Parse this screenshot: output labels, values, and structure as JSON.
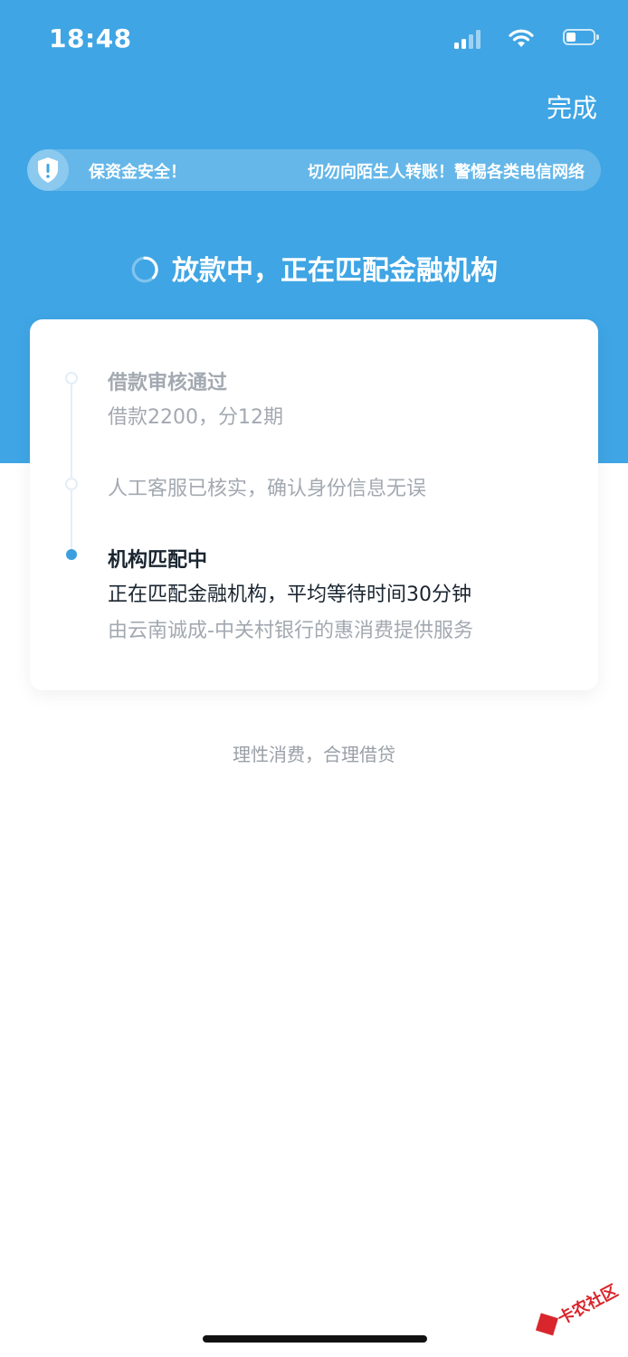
{
  "status_bar": {
    "time": "18:48"
  },
  "header": {
    "done_label": "完成"
  },
  "notice": {
    "left_text": "保资金安全！",
    "right_text": "切勿向陌生人转账！警惕各类电信网络"
  },
  "status": {
    "title": "放款中，正在匹配金融机构"
  },
  "timeline": {
    "steps": [
      {
        "title": "借款审核通过",
        "detail": "借款2200，分12期",
        "state": "done"
      },
      {
        "title": "",
        "detail": "人工客服已核实，确认身份信息无误",
        "state": "done"
      },
      {
        "title": "机构匹配中",
        "detail": "正在匹配金融机构，平均等待时间30分钟",
        "note": "由云南诚成-中关村银行的惠消费提供服务",
        "state": "active"
      }
    ]
  },
  "footer": {
    "slogan": "理性消费，合理借贷"
  },
  "watermark": {
    "text": "卡农社区"
  },
  "colors": {
    "primary": "#3fa5e4",
    "active_dot": "#3b9fdf",
    "gray_text": "#a3a9b1",
    "dark_text": "#1a2530"
  }
}
